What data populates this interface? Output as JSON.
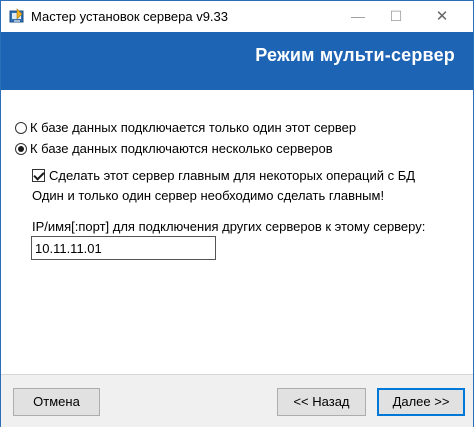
{
  "window": {
    "title": "Мастер установок сервера v9.33",
    "minimize_glyph": "—",
    "maximize_glyph": "☐",
    "close_glyph": "✕",
    "app_icon": "installer-icon"
  },
  "banner": {
    "title": "Режим мульти-сервер",
    "background": "#1e64b4"
  },
  "options": {
    "radio_single": {
      "label": "К базе данных подключается только один этот сервер",
      "checked": false
    },
    "radio_multi": {
      "label": "К базе данных подключаются несколько серверов",
      "checked": true
    },
    "checkbox_main": {
      "label": "Сделать этот сервер главным для некоторых операций с БД",
      "checked": true
    },
    "main_note": "Один и только один сервер необходимо сделать главным!"
  },
  "address": {
    "label": "IP/имя[:порт] для подключения других серверов к этому серверу:",
    "value": "10.11.11.01"
  },
  "footer": {
    "cancel_label": "Отмена",
    "back_label": "<< Назад",
    "next_label": "Далее >>"
  }
}
